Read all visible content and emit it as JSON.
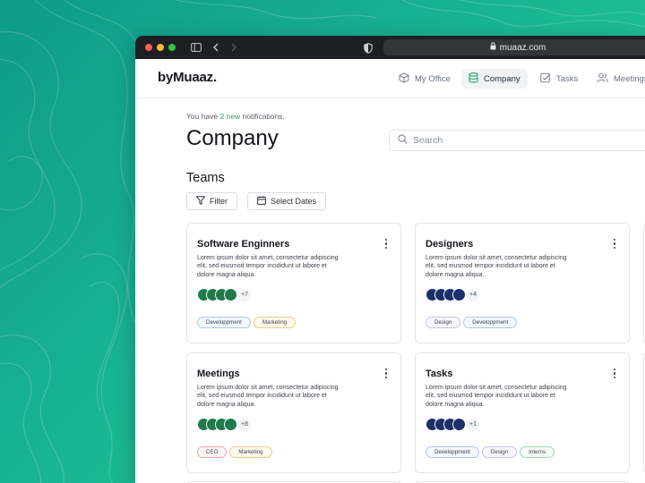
{
  "browser": {
    "url": "muaaz.com"
  },
  "nav": {
    "logo": "byMuaaz.",
    "items": [
      {
        "label": "My Office",
        "icon": "cube-icon",
        "active": false
      },
      {
        "label": "Company",
        "icon": "database-icon",
        "active": true
      },
      {
        "label": "Tasks",
        "icon": "checkbox-icon",
        "active": false
      },
      {
        "label": "Meetings",
        "icon": "users-icon",
        "active": false
      }
    ]
  },
  "notice": {
    "prefix": "You have ",
    "highlight": "2 new",
    "suffix": " notifications."
  },
  "page": {
    "title": "Company",
    "search_placeholder": "Search",
    "section_title": "Teams"
  },
  "toolbar": {
    "filter_label": "Filter",
    "dates_label": "Select Dates"
  },
  "colors": {
    "accent": "#22a866",
    "green_avatar": "#1f7a4c",
    "navy_avatar": "#1b2f6b"
  },
  "teams": [
    {
      "name": "Software Enginners",
      "description": "Lorem ipsum dolor sit amet, consectetur adipiscing elit, sed eiusmod tempor incididunt ut labore et dolore magna aliqua.",
      "avatar_color": "green",
      "extra_members": "+7",
      "tags": [
        "Developpment",
        "Marketing"
      ]
    },
    {
      "name": "Designers",
      "description": "Lorem ipsum dolor sit amet, consectetur adipiscing elit, sed eiusmod tempor incididunt ut labore et dolore magna aliqua.",
      "avatar_color": "navy",
      "extra_members": "+4",
      "tags": [
        "Design",
        "Developpment"
      ]
    },
    {
      "name": "Meetings",
      "description": "Lorem ipsum dolor sit amet, consectetur adipiscing elit, sed eiusmod tempor incididunt ut labore et dolore magna aliqua.",
      "avatar_color": "green",
      "extra_members": "+8",
      "tags": [
        "CEO",
        "Marketing"
      ]
    },
    {
      "name": "Tasks",
      "description": "Lorem ipsum dolor sit amet, consectetur adipiscing elit, sed eiusmod tempor incididunt ut labore et dolore magna aliqua.",
      "avatar_color": "navy",
      "extra_members": "+1",
      "tags": [
        "Developpment",
        "Design",
        "Interns"
      ]
    }
  ]
}
